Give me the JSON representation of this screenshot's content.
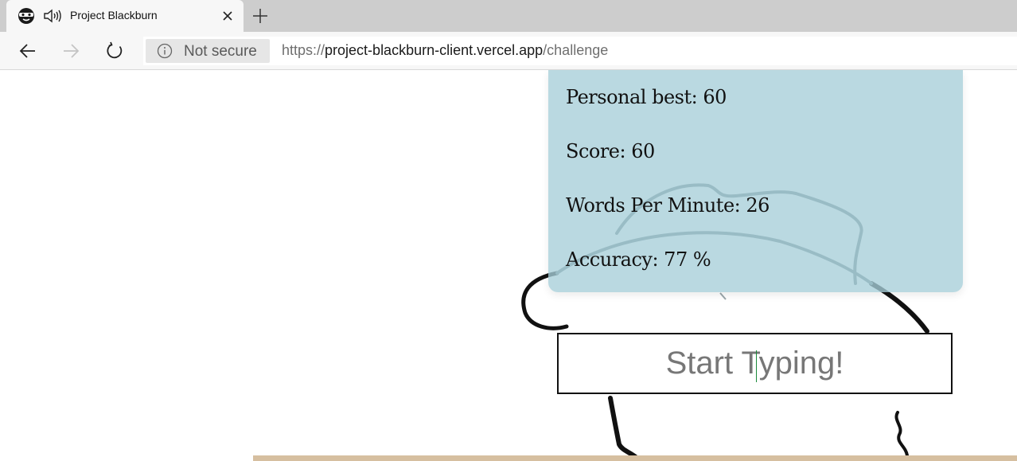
{
  "browser": {
    "tab": {
      "title": "Project Blackburn",
      "favicon": "masked-face-icon",
      "audio_icon": "speaker-playing-icon"
    },
    "toolbar": {
      "security_label": "Not secure",
      "url": {
        "scheme": "https://",
        "host": "project-blackburn-client.vercel.app",
        "path": "/challenge"
      }
    }
  },
  "page": {
    "stats": {
      "personal_best": "Personal best: 60",
      "score": "Score: 60",
      "wpm": "Words Per Minute: 26",
      "accuracy": "Accuracy: 77 %"
    },
    "typing": {
      "placeholder": "Start Typing!",
      "value": ""
    }
  },
  "colors": {
    "card": "#a7ced8",
    "tabstrip": "#cdcdcd",
    "toolbar": "#f7f7f7",
    "floor": "#d6bfa0"
  }
}
